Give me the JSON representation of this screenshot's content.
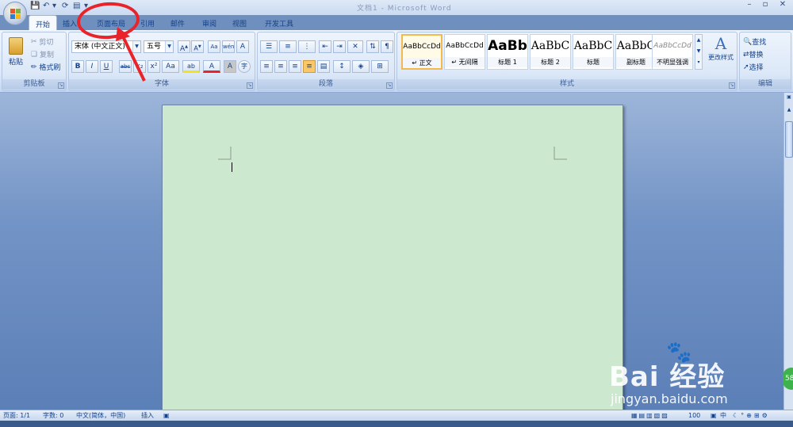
{
  "title_bar": {
    "title": "文档1 - Microsoft Word"
  },
  "tabs": [
    "开始",
    "插入",
    "页面布局",
    "引用",
    "邮件",
    "审阅",
    "视图",
    "开发工具"
  ],
  "clipboard": {
    "paste": "粘贴",
    "cut": "剪切",
    "copy": "复制",
    "format_painter": "格式刷",
    "label": "剪贴板"
  },
  "font": {
    "name": "宋体 (中文正文)",
    "size": "五号",
    "grow": "A",
    "shrink": "A",
    "label": "字体",
    "bold": "B",
    "italic": "I",
    "underline": "U",
    "strike": "abc",
    "sub": "x₂",
    "sup": "x²",
    "case": "Aa",
    "highlight": "ab",
    "color": "A",
    "charshade": "A",
    "enclose": "字"
  },
  "paragraph": {
    "label": "段落"
  },
  "styles": {
    "label": "样式",
    "items": [
      {
        "sample": "AaBbCcDd",
        "name": "↵ 正文"
      },
      {
        "sample": "AaBbCcDd",
        "name": "↵ 无间隔"
      },
      {
        "sample": "AaBb",
        "name": "标题 1"
      },
      {
        "sample": "AaBbC",
        "name": "标题 2"
      },
      {
        "sample": "AaBbC",
        "name": "标题"
      },
      {
        "sample": "AaBbC",
        "name": "副标题"
      },
      {
        "sample": "AaBbCcDd",
        "name": "不明显强调"
      }
    ],
    "change": "更改样式"
  },
  "editing": {
    "find": "查找",
    "replace": "替换",
    "select": "选择",
    "label": "编辑"
  },
  "status": {
    "page": "页面: 1/1",
    "words": "字数: 0",
    "language": "中文(简体，中国)",
    "mode": "插入",
    "zoom": "100",
    "ime": "中"
  },
  "watermark": {
    "brand": "Bai 经验",
    "url": "jingyan.baidu.com"
  },
  "badge": "58",
  "colors": {
    "page_bg": "#cce8cf",
    "annotation": "#e8232a",
    "ribbon": "#dce8f8"
  }
}
